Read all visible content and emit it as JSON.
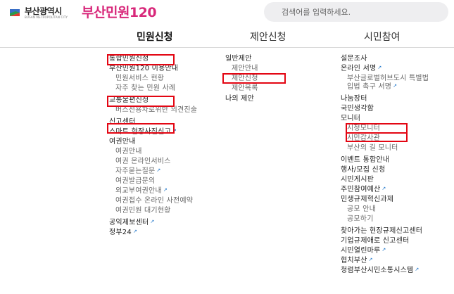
{
  "header": {
    "city_name": "부산광역시",
    "city_name_en": "BUSAN METROPOLITAN CITY",
    "service_name": "부산민원120",
    "search_placeholder": "검색어를 입력하세요."
  },
  "nav": {
    "tabs": [
      {
        "label": "민원신청",
        "active": true
      },
      {
        "label": "제안신청",
        "active": false
      },
      {
        "label": "시민참여",
        "active": false
      }
    ]
  },
  "columns": {
    "civil": [
      {
        "label": "통합민원신청",
        "boxed": true
      },
      {
        "label": "부산민원120 이용안내"
      },
      {
        "label": "민원서비스 현황",
        "sub": true
      },
      {
        "label": "자주 찾는 민원 사례",
        "sub": true
      },
      {
        "label": "교통불편신청",
        "boxed": true
      },
      {
        "label": "버스전용차로위반 의견진술",
        "sub": true
      },
      {
        "label": "신고센터",
        "boxed": true
      },
      {
        "label": "스마트 현장사진신고",
        "external": true
      },
      {
        "label": "여권안내"
      },
      {
        "label": "여권안내",
        "sub": true
      },
      {
        "label": "여권 온라인서비스",
        "sub": true
      },
      {
        "label": "자주묻는질문",
        "sub": true,
        "external": true
      },
      {
        "label": "여권발급문의",
        "sub": true
      },
      {
        "label": "외교부여권안내",
        "sub": true,
        "external": true
      },
      {
        "label": "여권접수 온라인 사전예약",
        "sub": true
      },
      {
        "label": "여권민원 대기현황",
        "sub": true
      },
      {
        "label": "공익제보센터",
        "external": true
      },
      {
        "label": "정부24",
        "external": true
      }
    ],
    "proposal": [
      {
        "label": "일반제안"
      },
      {
        "label": "제안안내",
        "sub": true
      },
      {
        "label": "제안신청",
        "sub": true,
        "boxed": true
      },
      {
        "label": "제안목록",
        "sub": true
      },
      {
        "label": "나의 제안"
      }
    ],
    "citizen": [
      {
        "label": "설문조사"
      },
      {
        "label": "온라인 서명",
        "external": true
      },
      {
        "label": "부산글로벌허브도시 특별법 입법 촉구 서명",
        "sub": true,
        "external": true
      },
      {
        "label": "나눔장터"
      },
      {
        "label": "국민생각함"
      },
      {
        "label": "모니터"
      },
      {
        "label": "시정모니터",
        "sub": true,
        "boxed": true
      },
      {
        "label": "시민감사관",
        "sub": true,
        "boxed": true
      },
      {
        "label": "부산의 길 모니터",
        "sub": true
      },
      {
        "label": "이벤트 통합안내"
      },
      {
        "label": "행사/모집 신청"
      },
      {
        "label": "시민게시판"
      },
      {
        "label": "주민참여예산",
        "external": true
      },
      {
        "label": "민생규제혁신과제"
      },
      {
        "label": "공모 안내",
        "sub": true
      },
      {
        "label": "공모하기",
        "sub": true
      },
      {
        "label": "찾아가는 현장규제신고센터"
      },
      {
        "label": "기업규제애로 신고센터"
      },
      {
        "label": "시민열린마루",
        "external": true
      },
      {
        "label": "협치부산",
        "external": true
      },
      {
        "label": "청렴부산시민소통시스템",
        "external": true
      }
    ]
  },
  "colors": {
    "brand": "#d8287a",
    "highlight_box": "#e30613",
    "external_icon": "#1a73c9"
  },
  "icons": {
    "external": "external-link-icon",
    "logo": "busan-emblem-icon"
  }
}
